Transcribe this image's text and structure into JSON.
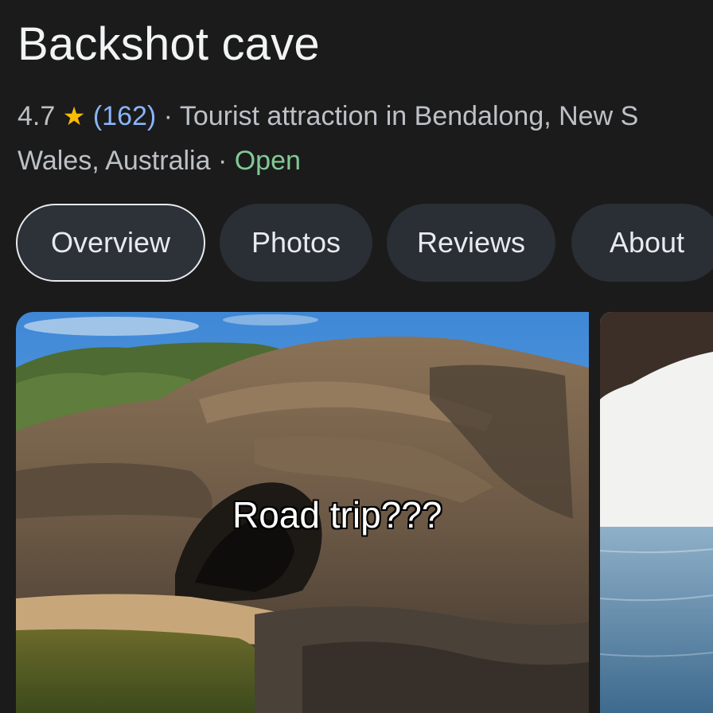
{
  "place": {
    "name": "Backshot cave",
    "rating": "4.7",
    "star_glyph": "★",
    "review_count": "(162)",
    "separator": " · ",
    "category_line1": "Tourist attraction in Bendalong, New S",
    "category_line2": "Wales, Australia",
    "status": "Open"
  },
  "tabs": [
    {
      "label": "Overview",
      "active": true
    },
    {
      "label": "Photos",
      "active": false
    },
    {
      "label": "Reviews",
      "active": false
    },
    {
      "label": "About",
      "active": false
    }
  ],
  "photos": {
    "overlay_caption": "Road trip???"
  },
  "colors": {
    "background": "#1b1b1b",
    "star": "#fbbc04",
    "review_count": "#8ab4f8",
    "open_status": "#81c995",
    "tab_bg": "#2a2e35"
  }
}
